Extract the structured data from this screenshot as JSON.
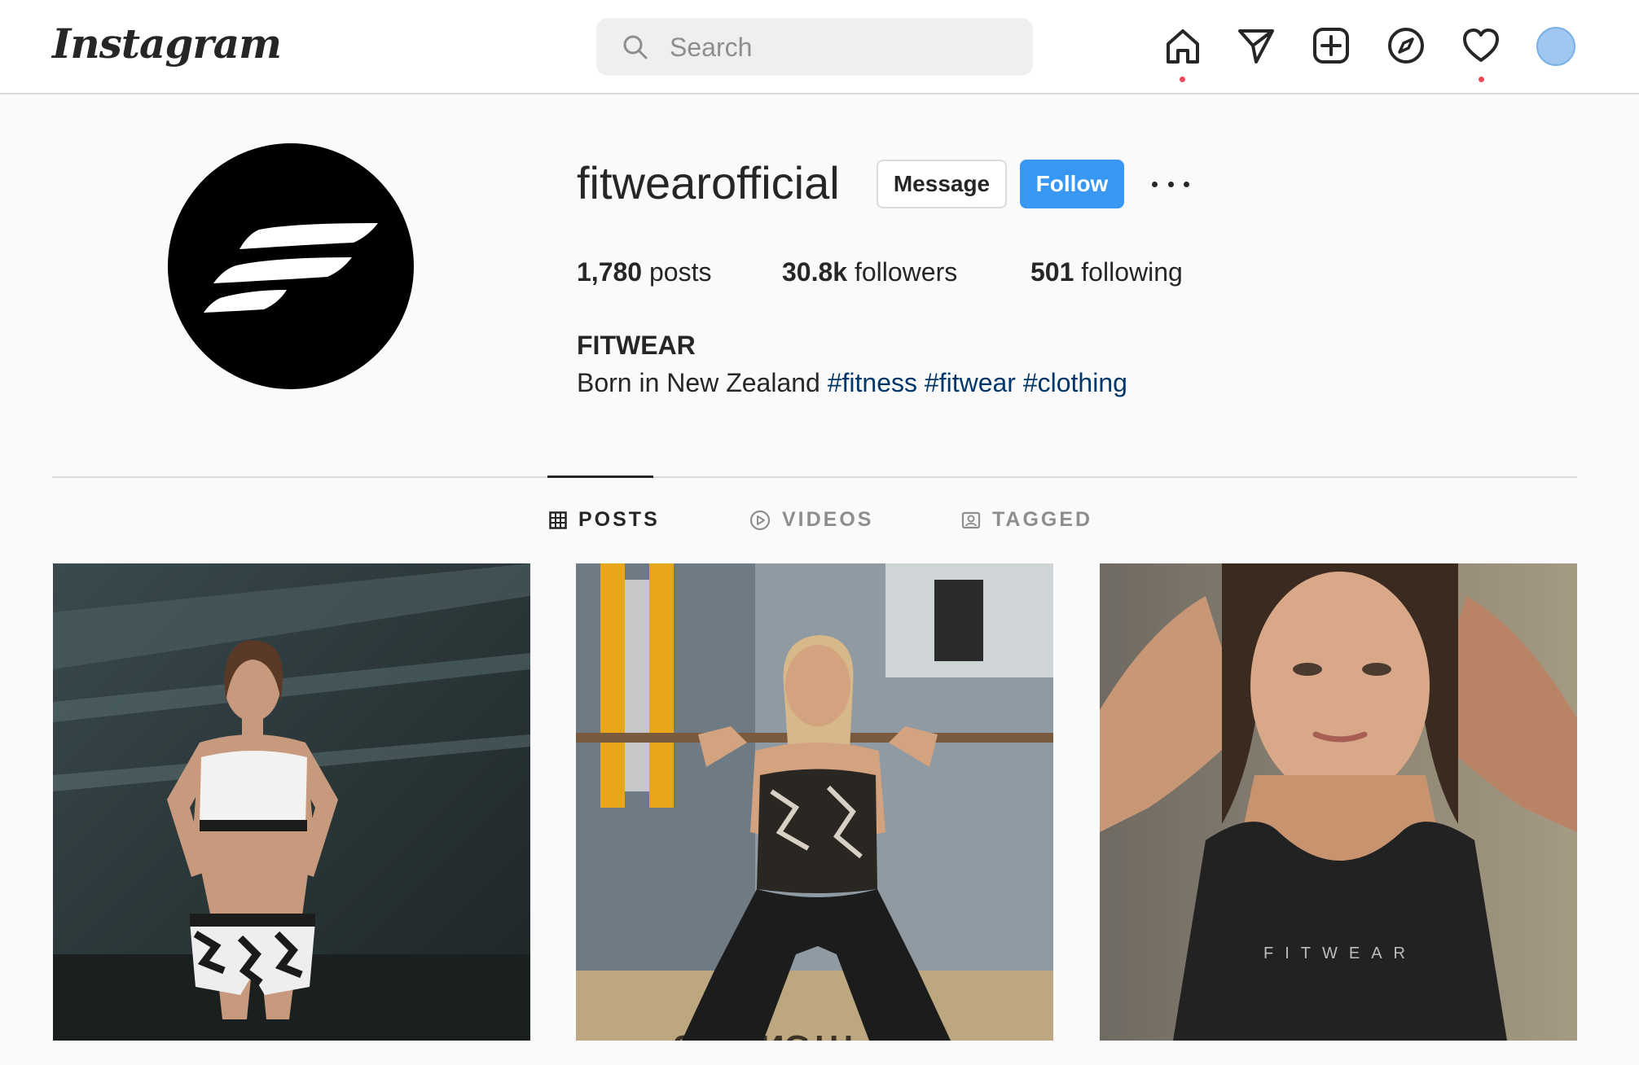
{
  "nav": {
    "logo": "Instagram",
    "search_placeholder": "Search",
    "icons": [
      "home-icon",
      "direct-icon",
      "new-post-icon",
      "explore-icon",
      "activity-icon",
      "profile-avatar"
    ]
  },
  "profile": {
    "username": "fitwearofficial",
    "message_label": "Message",
    "follow_label": "Follow",
    "stats": {
      "posts_count": "1,780",
      "posts_label": "posts",
      "followers_count": "30.8k",
      "followers_label": "followers",
      "following_count": "501",
      "following_label": "following"
    },
    "full_name": "FITWEAR",
    "bio_text": "Born in New Zealand",
    "hashtags": [
      "#fitness",
      "#fitwear",
      "#clothing"
    ]
  },
  "tabs": [
    {
      "label": "POSTS",
      "icon": "grid-icon",
      "active": true
    },
    {
      "label": "VIDEOS",
      "icon": "play-icon",
      "active": false
    },
    {
      "label": "TAGGED",
      "icon": "tag-icon",
      "active": false
    }
  ],
  "posts": [
    {
      "brand_text": ""
    },
    {
      "brand_text": ""
    },
    {
      "brand_text": "FITWEAR"
    }
  ],
  "colors": {
    "accent": "#3897f0",
    "notification": "#ed4956",
    "hashtag": "#00376b"
  }
}
